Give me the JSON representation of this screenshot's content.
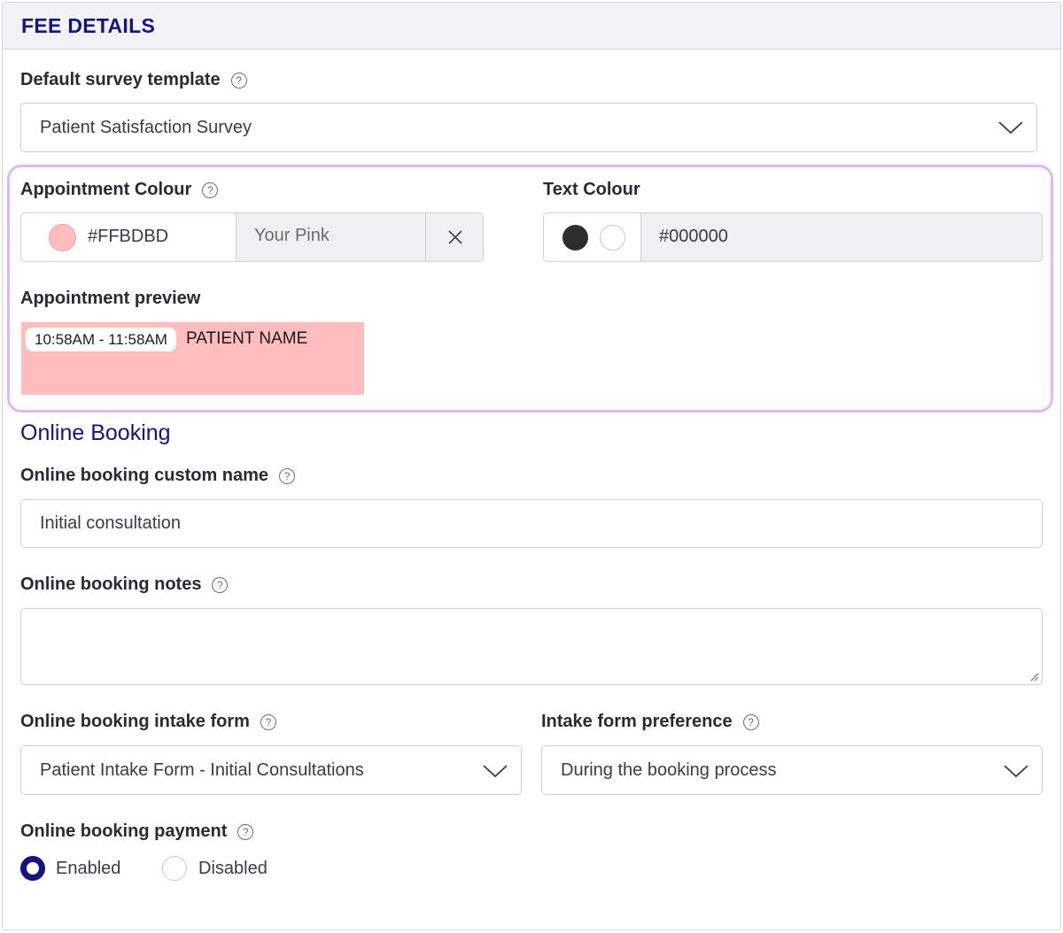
{
  "card": {
    "title": "FEE DETAILS"
  },
  "survey": {
    "label": "Default survey template",
    "value": "Patient Satisfaction Survey"
  },
  "appointment_colour": {
    "label": "Appointment Colour",
    "hex": "#FFBDBD",
    "name": "Your Pink",
    "swatch_color": "#FFBDBD"
  },
  "text_colour": {
    "label": "Text Colour",
    "hex": "#000000",
    "selected": "dark"
  },
  "preview": {
    "label": "Appointment preview",
    "time": "10:58AM - 11:58AM",
    "patient": "PATIENT NAME"
  },
  "online_booking": {
    "section_title": "Online Booking",
    "custom_name_label": "Online booking custom name",
    "custom_name_value": "Initial consultation",
    "notes_label": "Online booking notes",
    "notes_value": "",
    "intake_form_label": "Online booking intake form",
    "intake_form_value": "Patient Intake Form - Initial Consultations",
    "intake_pref_label": "Intake form preference",
    "intake_pref_value": "During the booking process",
    "payment_label": "Online booking payment",
    "payment_options": [
      "Enabled",
      "Disabled"
    ],
    "payment_selected": "Enabled"
  },
  "colors": {
    "accent": "#141480",
    "highlight_border": "#e4b5f2",
    "header_bg": "#f3f3f7"
  }
}
